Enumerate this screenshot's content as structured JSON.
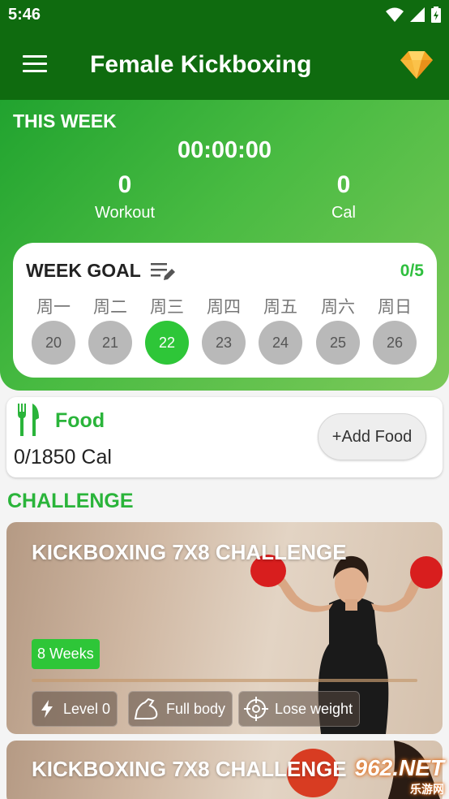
{
  "status_bar": {
    "time": "5:46"
  },
  "app_bar": {
    "title": "Female Kickboxing"
  },
  "this_week": {
    "heading": "THIS WEEK",
    "timer": "00:00:00",
    "workout": {
      "value": "0",
      "label": "Workout"
    },
    "calories": {
      "value": "0",
      "label": "Cal"
    }
  },
  "week_goal": {
    "title": "WEEK GOAL",
    "progress": "0/5",
    "days": [
      {
        "label": "周一",
        "date": "20"
      },
      {
        "label": "周二",
        "date": "21"
      },
      {
        "label": "周三",
        "date": "22"
      },
      {
        "label": "周四",
        "date": "23"
      },
      {
        "label": "周五",
        "date": "24"
      },
      {
        "label": "周六",
        "date": "25"
      },
      {
        "label": "周日",
        "date": "26"
      }
    ],
    "active_date": "22"
  },
  "food": {
    "title": "Food",
    "calories": "0/1850 Cal",
    "add_button": "+Add Food"
  },
  "challenge_section": {
    "title": "CHALLENGE"
  },
  "challenges": [
    {
      "title": "KICKBOXING 7X8 CHALLENGE",
      "duration": "8 Weeks",
      "progress": 0,
      "tags": {
        "level": "Level 0",
        "body": "Full body",
        "goal": "Lose weight"
      }
    },
    {
      "title": "KICKBOXING 7X8 CHALLENGE"
    }
  ],
  "watermark": {
    "brand": "962.NET",
    "sub": "乐游网"
  },
  "colors": {
    "primary_dark": "#0f6b0f",
    "accent_green": "#2ec638",
    "gem": "#f5a623"
  }
}
